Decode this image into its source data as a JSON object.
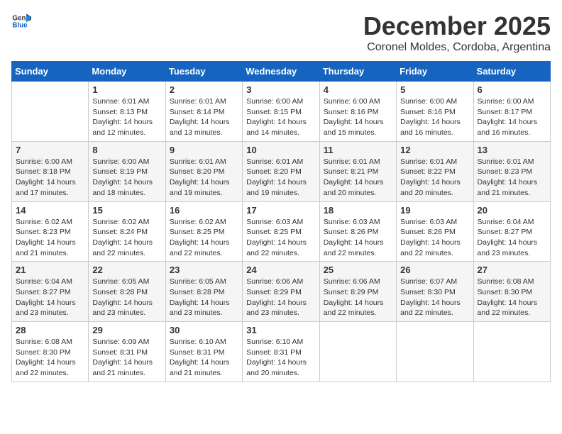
{
  "header": {
    "logo_general": "General",
    "logo_blue": "Blue",
    "month": "December 2025",
    "location": "Coronel Moldes, Cordoba, Argentina"
  },
  "weekdays": [
    "Sunday",
    "Monday",
    "Tuesday",
    "Wednesday",
    "Thursday",
    "Friday",
    "Saturday"
  ],
  "weeks": [
    [
      {
        "day": "",
        "info": ""
      },
      {
        "day": "1",
        "info": "Sunrise: 6:01 AM\nSunset: 8:13 PM\nDaylight: 14 hours\nand 12 minutes."
      },
      {
        "day": "2",
        "info": "Sunrise: 6:01 AM\nSunset: 8:14 PM\nDaylight: 14 hours\nand 13 minutes."
      },
      {
        "day": "3",
        "info": "Sunrise: 6:00 AM\nSunset: 8:15 PM\nDaylight: 14 hours\nand 14 minutes."
      },
      {
        "day": "4",
        "info": "Sunrise: 6:00 AM\nSunset: 8:16 PM\nDaylight: 14 hours\nand 15 minutes."
      },
      {
        "day": "5",
        "info": "Sunrise: 6:00 AM\nSunset: 8:16 PM\nDaylight: 14 hours\nand 16 minutes."
      },
      {
        "day": "6",
        "info": "Sunrise: 6:00 AM\nSunset: 8:17 PM\nDaylight: 14 hours\nand 16 minutes."
      }
    ],
    [
      {
        "day": "7",
        "info": "Sunrise: 6:00 AM\nSunset: 8:18 PM\nDaylight: 14 hours\nand 17 minutes."
      },
      {
        "day": "8",
        "info": "Sunrise: 6:00 AM\nSunset: 8:19 PM\nDaylight: 14 hours\nand 18 minutes."
      },
      {
        "day": "9",
        "info": "Sunrise: 6:01 AM\nSunset: 8:20 PM\nDaylight: 14 hours\nand 19 minutes."
      },
      {
        "day": "10",
        "info": "Sunrise: 6:01 AM\nSunset: 8:20 PM\nDaylight: 14 hours\nand 19 minutes."
      },
      {
        "day": "11",
        "info": "Sunrise: 6:01 AM\nSunset: 8:21 PM\nDaylight: 14 hours\nand 20 minutes."
      },
      {
        "day": "12",
        "info": "Sunrise: 6:01 AM\nSunset: 8:22 PM\nDaylight: 14 hours\nand 20 minutes."
      },
      {
        "day": "13",
        "info": "Sunrise: 6:01 AM\nSunset: 8:23 PM\nDaylight: 14 hours\nand 21 minutes."
      }
    ],
    [
      {
        "day": "14",
        "info": "Sunrise: 6:02 AM\nSunset: 8:23 PM\nDaylight: 14 hours\nand 21 minutes."
      },
      {
        "day": "15",
        "info": "Sunrise: 6:02 AM\nSunset: 8:24 PM\nDaylight: 14 hours\nand 22 minutes."
      },
      {
        "day": "16",
        "info": "Sunrise: 6:02 AM\nSunset: 8:25 PM\nDaylight: 14 hours\nand 22 minutes."
      },
      {
        "day": "17",
        "info": "Sunrise: 6:03 AM\nSunset: 8:25 PM\nDaylight: 14 hours\nand 22 minutes."
      },
      {
        "day": "18",
        "info": "Sunrise: 6:03 AM\nSunset: 8:26 PM\nDaylight: 14 hours\nand 22 minutes."
      },
      {
        "day": "19",
        "info": "Sunrise: 6:03 AM\nSunset: 8:26 PM\nDaylight: 14 hours\nand 22 minutes."
      },
      {
        "day": "20",
        "info": "Sunrise: 6:04 AM\nSunset: 8:27 PM\nDaylight: 14 hours\nand 23 minutes."
      }
    ],
    [
      {
        "day": "21",
        "info": "Sunrise: 6:04 AM\nSunset: 8:27 PM\nDaylight: 14 hours\nand 23 minutes."
      },
      {
        "day": "22",
        "info": "Sunrise: 6:05 AM\nSunset: 8:28 PM\nDaylight: 14 hours\nand 23 minutes."
      },
      {
        "day": "23",
        "info": "Sunrise: 6:05 AM\nSunset: 8:28 PM\nDaylight: 14 hours\nand 23 minutes."
      },
      {
        "day": "24",
        "info": "Sunrise: 6:06 AM\nSunset: 8:29 PM\nDaylight: 14 hours\nand 23 minutes."
      },
      {
        "day": "25",
        "info": "Sunrise: 6:06 AM\nSunset: 8:29 PM\nDaylight: 14 hours\nand 22 minutes."
      },
      {
        "day": "26",
        "info": "Sunrise: 6:07 AM\nSunset: 8:30 PM\nDaylight: 14 hours\nand 22 minutes."
      },
      {
        "day": "27",
        "info": "Sunrise: 6:08 AM\nSunset: 8:30 PM\nDaylight: 14 hours\nand 22 minutes."
      }
    ],
    [
      {
        "day": "28",
        "info": "Sunrise: 6:08 AM\nSunset: 8:30 PM\nDaylight: 14 hours\nand 22 minutes."
      },
      {
        "day": "29",
        "info": "Sunrise: 6:09 AM\nSunset: 8:31 PM\nDaylight: 14 hours\nand 21 minutes."
      },
      {
        "day": "30",
        "info": "Sunrise: 6:10 AM\nSunset: 8:31 PM\nDaylight: 14 hours\nand 21 minutes."
      },
      {
        "day": "31",
        "info": "Sunrise: 6:10 AM\nSunset: 8:31 PM\nDaylight: 14 hours\nand 20 minutes."
      },
      {
        "day": "",
        "info": ""
      },
      {
        "day": "",
        "info": ""
      },
      {
        "day": "",
        "info": ""
      }
    ]
  ]
}
